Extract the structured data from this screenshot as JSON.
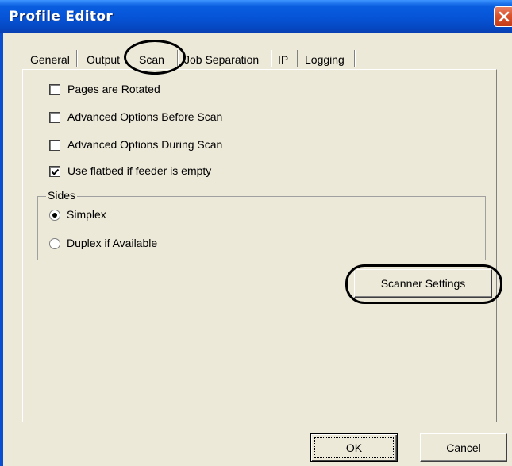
{
  "window": {
    "title": "Profile Editor",
    "close_icon": "close-icon"
  },
  "tabs": [
    {
      "label": "General",
      "selected": false
    },
    {
      "label": "Output",
      "selected": false
    },
    {
      "label": "Scan",
      "selected": true
    },
    {
      "label": "Job Separation",
      "selected": false
    },
    {
      "label": "IP",
      "selected": false
    },
    {
      "label": "Logging",
      "selected": false
    }
  ],
  "scan_options": {
    "pages_rotated": {
      "label": "Pages are Rotated",
      "checked": false
    },
    "advanced_before": {
      "label": "Advanced Options Before Scan",
      "checked": false
    },
    "advanced_during": {
      "label": "Advanced Options During Scan",
      "checked": false
    },
    "use_flatbed": {
      "label": "Use flatbed if feeder is empty",
      "checked": true
    }
  },
  "sides": {
    "legend": "Sides",
    "options": [
      {
        "label": "Simplex",
        "selected": true
      },
      {
        "label": "Duplex if Available",
        "selected": false
      }
    ]
  },
  "buttons": {
    "scanner_settings": "Scanner Settings",
    "ok": "OK",
    "cancel": "Cancel"
  },
  "colors": {
    "titlebar": "#0653d6",
    "dialog_face": "#ece9d8",
    "close_button": "#d9532c"
  }
}
